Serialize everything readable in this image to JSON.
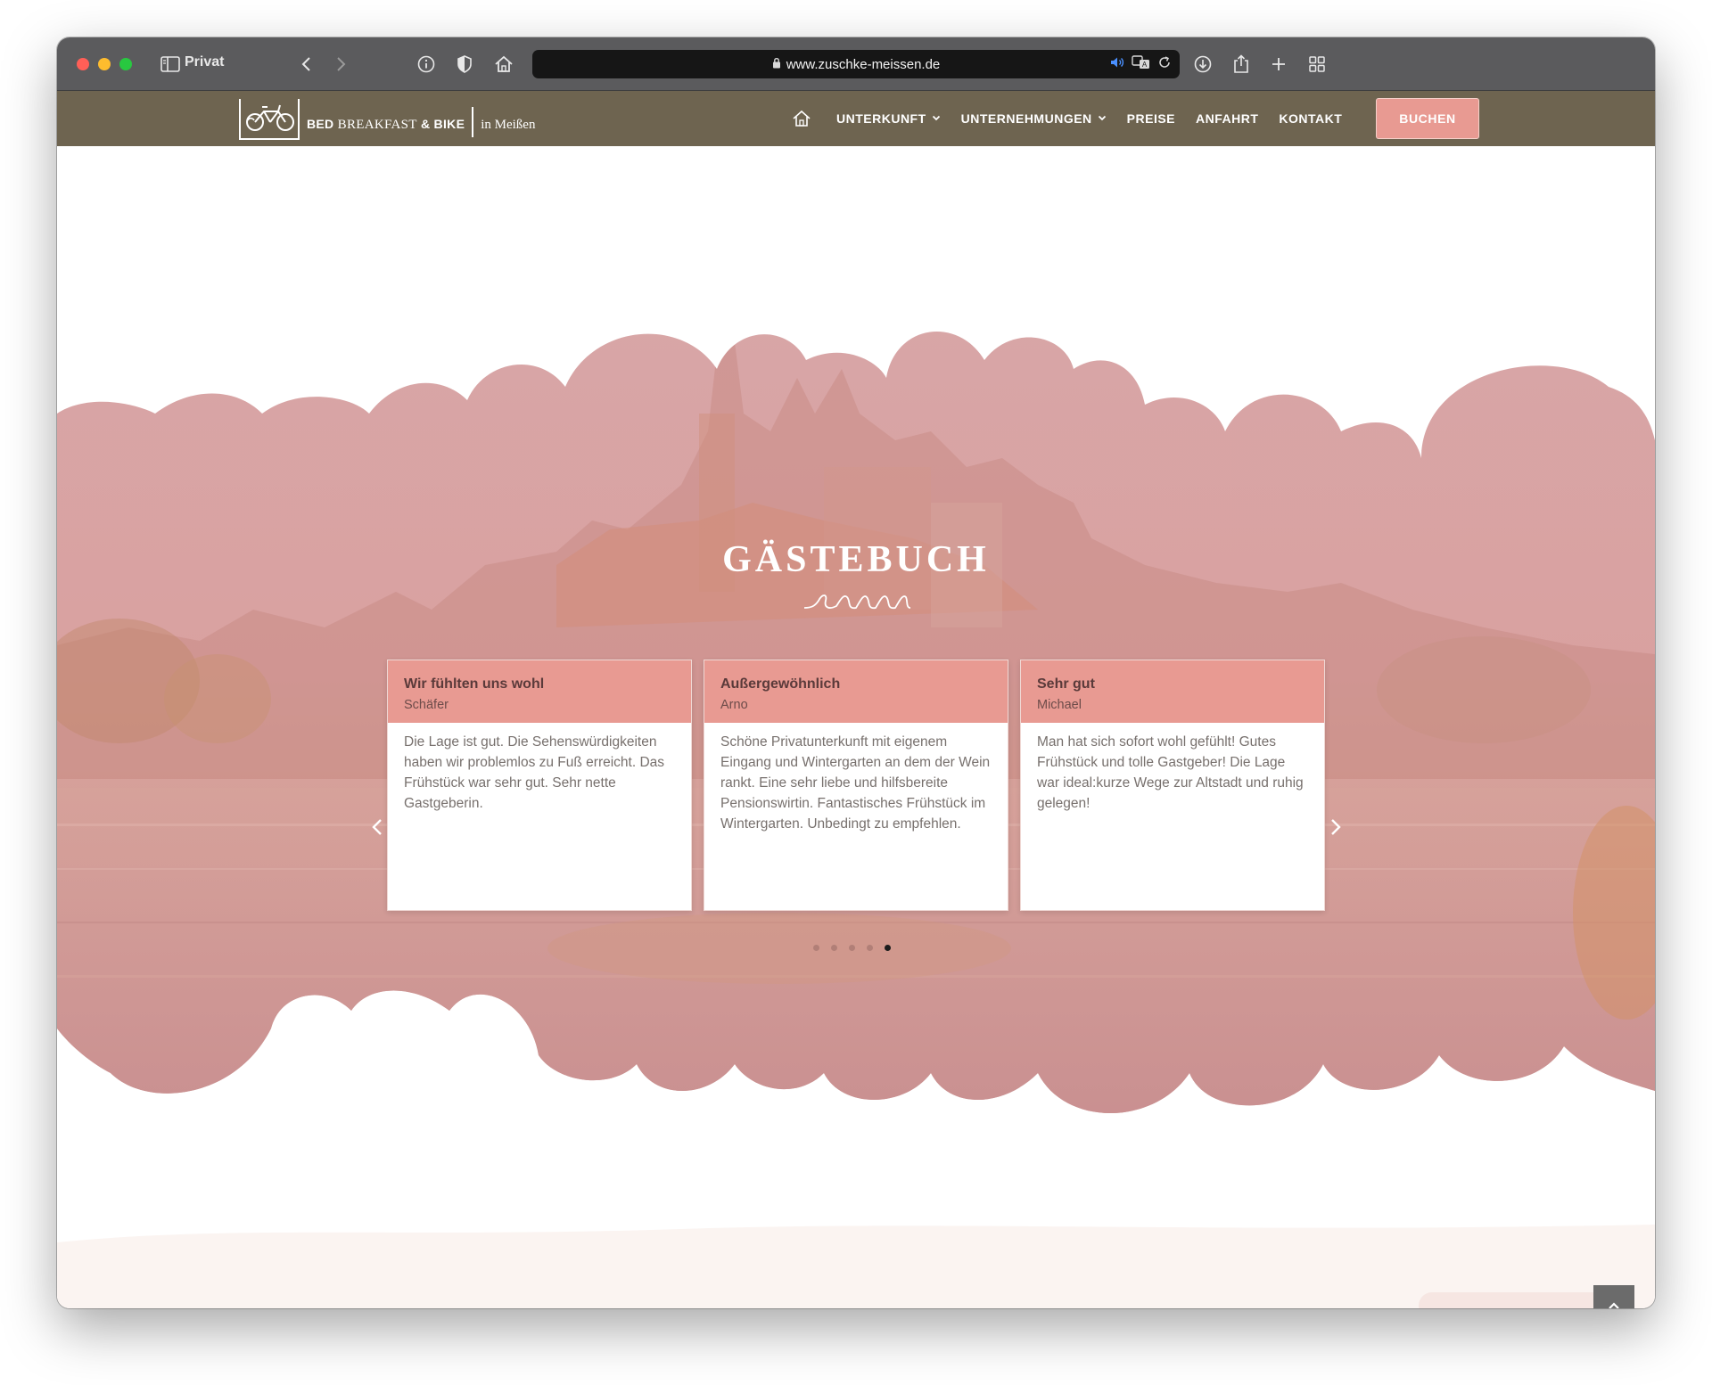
{
  "browser": {
    "profile_label": "Privat",
    "url": "www.zuschke-meissen.de"
  },
  "site": {
    "logo": {
      "name_part1": "BED ",
      "name_part2": "BREAKFAST",
      "name_part3": " & BIKE",
      "city": "in Meißen"
    },
    "nav": {
      "items": [
        "UNTERKUNFT",
        "UNTERNEHMUNGEN",
        "PREISE",
        "ANFAHRT",
        "KONTAKT"
      ],
      "book_label": "BUCHEN"
    }
  },
  "guestbook": {
    "title": "GÄSTEBUCH",
    "entries": [
      {
        "title": "Wir fühlten uns wohl",
        "author": "Schäfer",
        "text": "Die Lage ist gut. Die Sehenswürdigkeiten haben wir problemlos zu Fuß erreicht. Das Frühstück war sehr gut. Sehr nette Gastgeberin."
      },
      {
        "title": "Außergewöhnlich",
        "author": "Arno",
        "text": "Schöne Privatunterkunft mit eigenem Eingang und Wintergarten an dem der Wein rankt. Eine sehr liebe und hilfsbereite Pensionswirtin. Fantastisches Frühstück im Wintergarten. Unbedingt zu empfehlen."
      },
      {
        "title": "Sehr gut",
        "author": "Michael",
        "text": "Man hat sich sofort wohl gefühlt! Gutes Frühstück und tolle Gastgeber! Die Lage war ideal:kurze Wege zur Altstadt und ruhig gelegen!"
      }
    ],
    "slide_count": 5,
    "active_slide": 5
  },
  "colors": {
    "nav_bg": "#6e6450",
    "accent": "#e89a92"
  }
}
